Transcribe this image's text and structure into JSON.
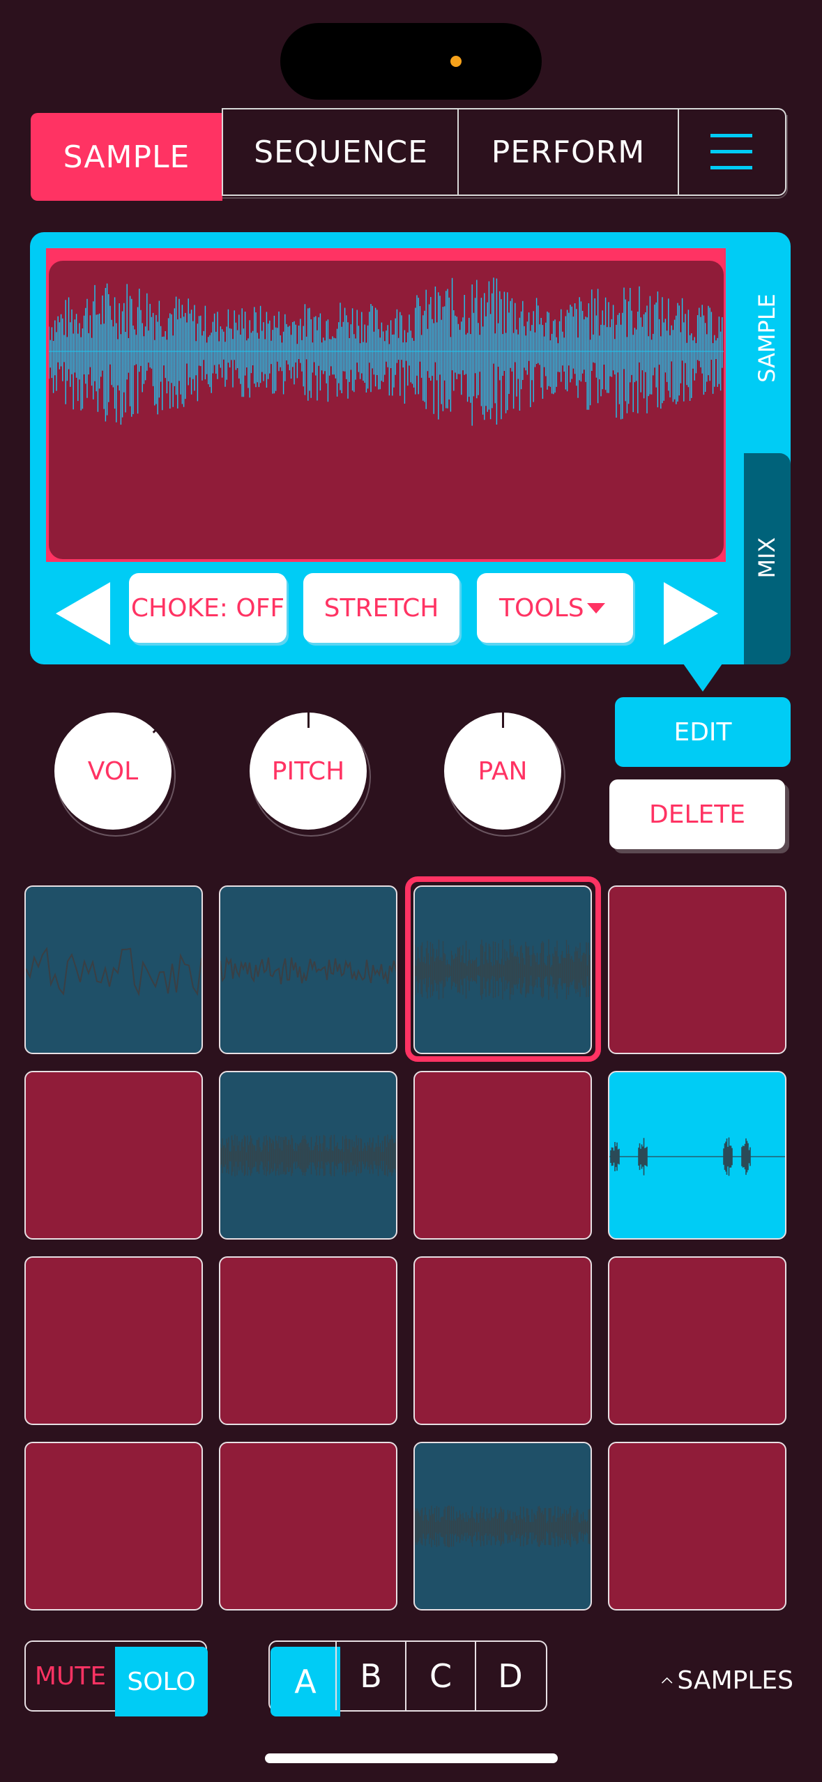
{
  "tabs": {
    "sample": "SAMPLE",
    "sequence": "SEQUENCE",
    "perform": "PERFORM",
    "menu_icon": "hamburger-menu-icon"
  },
  "editor": {
    "side_tabs": [
      "SAMPLE",
      "MIX"
    ],
    "choke": "CHOKE: OFF",
    "stretch": "STRETCH",
    "tools": "TOOLS",
    "prev_icon": "triangle-left-icon",
    "next_icon": "triangle-right-icon"
  },
  "knobs": {
    "vol": {
      "label": "VOL",
      "value": 0.85
    },
    "pitch": {
      "label": "PITCH",
      "value": 0.5
    },
    "pan": {
      "label": "PAN",
      "value": 0.5
    }
  },
  "actions": {
    "edit": "EDIT",
    "delete": "DELETE"
  },
  "pads": {
    "selected_index": 2,
    "states": [
      "loaded",
      "loaded",
      "loaded",
      "empty",
      "empty",
      "loaded",
      "empty",
      "active",
      "empty",
      "empty",
      "empty",
      "empty",
      "empty",
      "empty",
      "loaded",
      "empty"
    ]
  },
  "bottom": {
    "mute": "MUTE",
    "solo": "SOLO",
    "banks": [
      "A",
      "B",
      "C",
      "D"
    ],
    "selected_bank": "A",
    "samples": "SAMPLES"
  },
  "colors": {
    "background": "#2c111d",
    "accent_pink": "#ff3363",
    "accent_cyan": "#00ccf5",
    "pad_empty": "#901c39",
    "pad_loaded": "#1f5068"
  }
}
